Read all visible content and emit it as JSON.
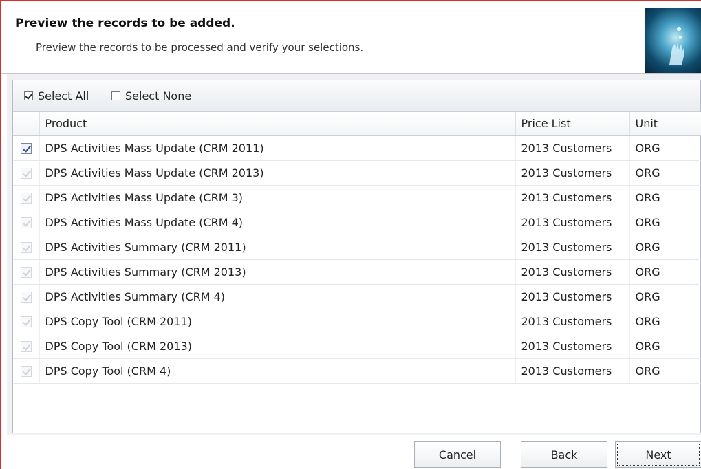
{
  "header": {
    "title": "Preview the records to be added.",
    "subtitle": "Preview the records to be processed and verify your selections."
  },
  "toolbar": {
    "select_all": "Select All",
    "select_none": "Select None"
  },
  "table": {
    "columns": [
      "",
      "Product",
      "Price List",
      "Unit"
    ],
    "rows": [
      {
        "product": "DPS Activities Mass Update  (CRM 2011)",
        "price_list": "2013 Customers",
        "unit": "ORG",
        "checked": true,
        "active": true
      },
      {
        "product": "DPS Activities Mass Update  (CRM 2013)",
        "price_list": "2013 Customers",
        "unit": "ORG",
        "checked": true,
        "active": false
      },
      {
        "product": "DPS Activities Mass Update  (CRM 3)",
        "price_list": "2013 Customers",
        "unit": "ORG",
        "checked": true,
        "active": false
      },
      {
        "product": "DPS Activities Mass Update  (CRM 4)",
        "price_list": "2013 Customers",
        "unit": "ORG",
        "checked": true,
        "active": false
      },
      {
        "product": "DPS Activities Summary (CRM 2011)",
        "price_list": "2013 Customers",
        "unit": "ORG",
        "checked": true,
        "active": false
      },
      {
        "product": "DPS Activities Summary (CRM 2013)",
        "price_list": "2013 Customers",
        "unit": "ORG",
        "checked": true,
        "active": false
      },
      {
        "product": "DPS Activities Summary (CRM 4)",
        "price_list": "2013 Customers",
        "unit": "ORG",
        "checked": true,
        "active": false
      },
      {
        "product": "DPS Copy Tool (CRM 2011)",
        "price_list": "2013 Customers",
        "unit": "ORG",
        "checked": true,
        "active": false
      },
      {
        "product": "DPS Copy Tool (CRM 2013)",
        "price_list": "2013 Customers",
        "unit": "ORG",
        "checked": true,
        "active": false
      },
      {
        "product": "DPS Copy Tool (CRM 4)",
        "price_list": "2013 Customers",
        "unit": "ORG",
        "checked": true,
        "active": false
      }
    ]
  },
  "buttons": {
    "cancel": "Cancel",
    "back": "Back",
    "next": "Next"
  },
  "colors": {
    "frame_border": "#d9302b",
    "active_check": "#3a4c8a"
  }
}
